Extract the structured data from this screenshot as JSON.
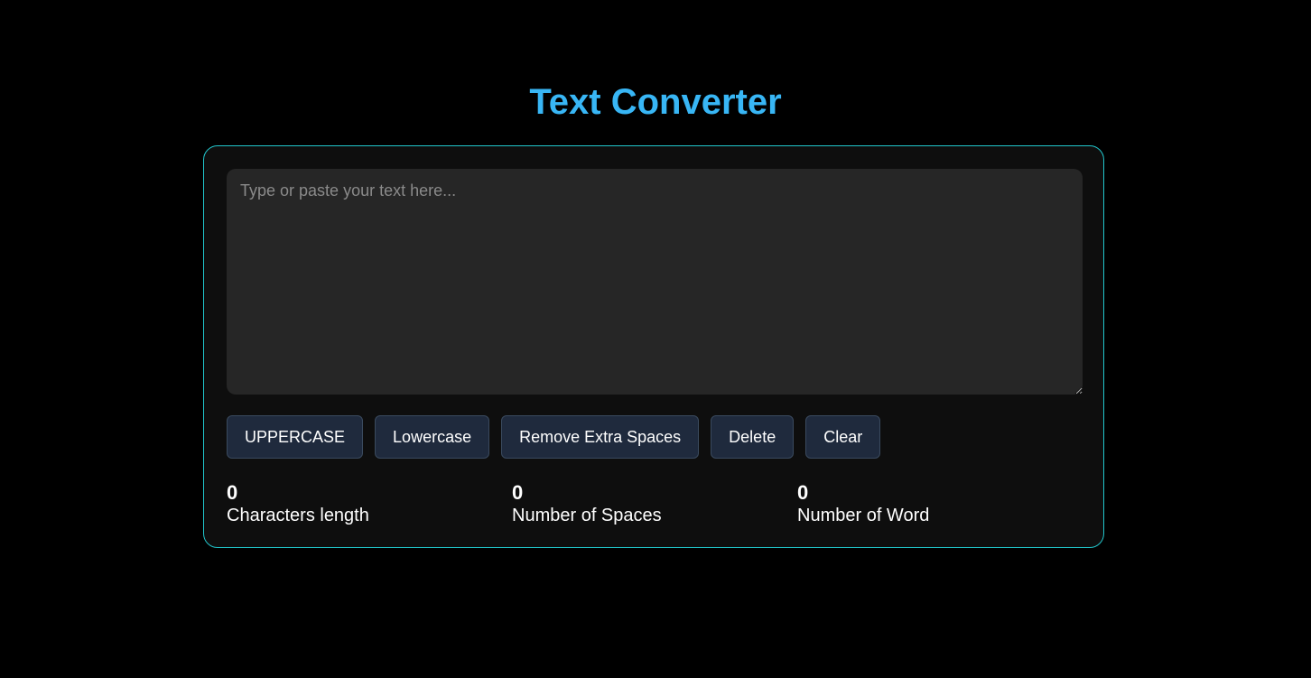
{
  "page": {
    "title": "Text Converter"
  },
  "editor": {
    "placeholder": "Type or paste your text here...",
    "value": ""
  },
  "buttons": {
    "uppercase": "UPPERCASE",
    "lowercase": "Lowercase",
    "remove_spaces": "Remove Extra Spaces",
    "delete": "Delete",
    "clear": "Clear"
  },
  "stats": [
    {
      "value": "0",
      "label": "Characters length"
    },
    {
      "value": "0",
      "label": "Number of Spaces"
    },
    {
      "value": "0",
      "label": "Number of Word"
    }
  ],
  "colors": {
    "title": "#38b6f5",
    "card_border": "#21c6cc",
    "button_bg": "#1f2a3d"
  }
}
